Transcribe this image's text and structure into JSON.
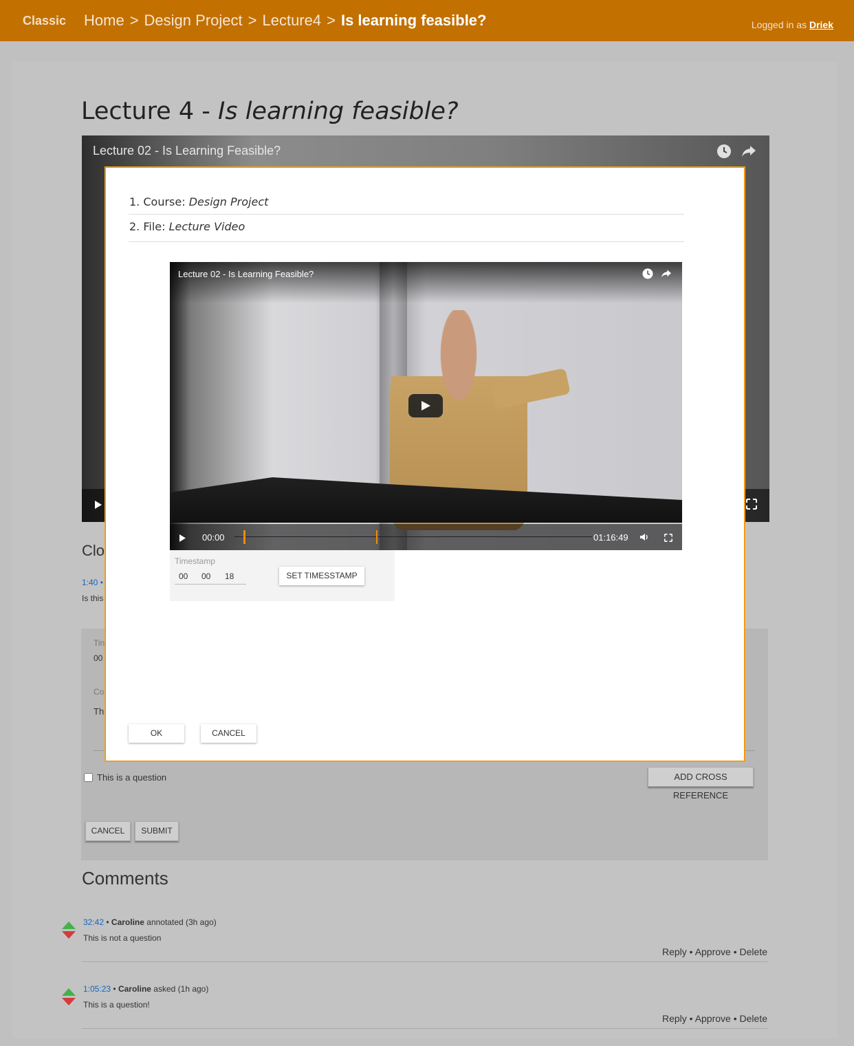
{
  "header": {
    "brand": "Classic",
    "breadcrumbs": [
      "Home",
      "Design Project",
      "Lecture4",
      "Is learning feasible?"
    ],
    "separator": ">",
    "logged_in_prefix": "Logged in as",
    "user": "Driek"
  },
  "page": {
    "title_prefix": "Lecture 4 -",
    "title_italic": "Is learning feasible?"
  },
  "background_video": {
    "title": "Lecture 02 - Is Learning Feasible?"
  },
  "background_section": {
    "heading_partial": "Clos",
    "timestamp": "1:40",
    "bullet": "•",
    "text_partial": "Is this",
    "form_label_1": "Tin",
    "form_value_1": "00",
    "form_label_2": "Co",
    "form_value_2": "Th",
    "checkbox_label": "This is a question",
    "add_cross_reference": "ADD CROSS REFERENCE",
    "cancel": "CANCEL",
    "submit": "SUBMIT"
  },
  "comments": {
    "title": "Comments",
    "items": [
      {
        "time": "32:42",
        "author": "Caroline",
        "verb": "annotated (3h ago)",
        "text": "This is not a question",
        "reply": "Reply",
        "approve": "Approve",
        "delete": "Delete"
      },
      {
        "time": "1:05:23",
        "author": "Caroline",
        "verb": "asked (1h ago)",
        "text": "This is a question!",
        "reply": "Reply",
        "approve": "Approve",
        "delete": "Delete"
      }
    ]
  },
  "modal": {
    "item1_label": "1. Course:",
    "item1_value": "Design Project",
    "item2_label": "2. File:",
    "item2_value": "Lecture Video",
    "player": {
      "title": "Lecture 02 - Is Learning Feasible?",
      "current_time": "00:00",
      "duration": "01:16:49"
    },
    "timestamp": {
      "label": "Timestamp",
      "hours": "00",
      "minutes": "00",
      "seconds": "18",
      "set_button": "SET TIMESSTAMP"
    },
    "ok": "OK",
    "cancel": "CANCEL"
  },
  "colors": {
    "header_bg": "#c27000",
    "accent": "#f28c00",
    "link": "#1565c0",
    "upvote": "#44b14a",
    "downvote": "#d23c3c"
  },
  "icons": [
    "clock-icon",
    "share-icon",
    "play-icon",
    "volume-icon",
    "fullscreen-icon",
    "upvote-icon",
    "downvote-icon"
  ]
}
